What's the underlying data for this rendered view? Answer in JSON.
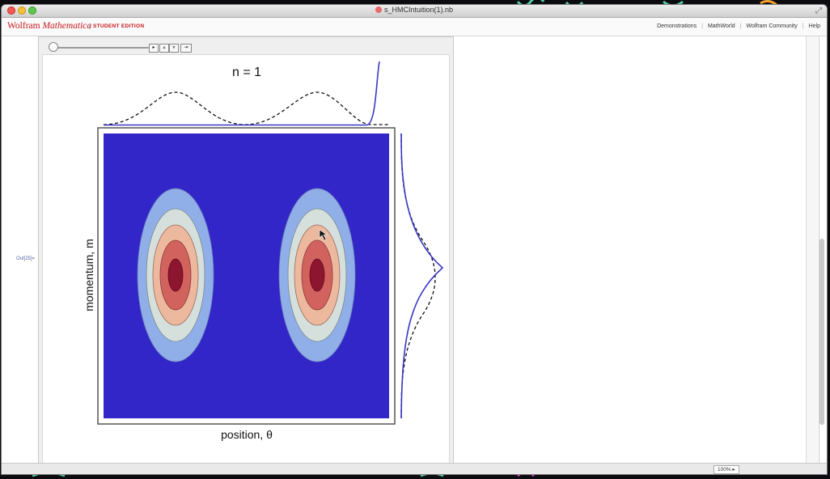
{
  "window": {
    "title": "s_HMCIntuition(1).nb"
  },
  "toolbar": {
    "brand_wolfram": "Wolfram",
    "brand_mathematica": "Mathematica",
    "edition": "STUDENT EDITION",
    "links": [
      "Demonstrations",
      "MathWorld",
      "Wolfram Community",
      "Help"
    ],
    "brand_color": "#c4161c"
  },
  "notebook": {
    "output_label": "Out[25]="
  },
  "manipulate": {
    "slider_value": 0,
    "buttons": [
      "play-icon",
      "step-forward-icon",
      "step-back-icon",
      "direction-icon"
    ],
    "button_glyphs": [
      "▸",
      "⩓",
      "⩔",
      "⇥"
    ]
  },
  "plot": {
    "title": "n = 1",
    "xlabel": "position, θ",
    "ylabel": "momentum, m",
    "colors": {
      "background": "#3226c8",
      "level1": "#90aee8",
      "level2": "#d5e0dc",
      "level3": "#ecb99f",
      "level4": "#d2625e",
      "level5": "#8e1530"
    }
  },
  "status": {
    "zoom": "100%"
  }
}
